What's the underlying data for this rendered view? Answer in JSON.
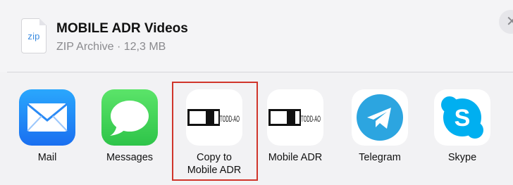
{
  "file": {
    "extension": "zip",
    "name": "MOBILE ADR Videos",
    "meta": "ZIP Archive · 12,3 MB"
  },
  "close": {
    "symbol": "✕"
  },
  "apps": [
    {
      "label": "Mail",
      "icon": "mail-icon"
    },
    {
      "label": "Messages",
      "icon": "messages-icon"
    },
    {
      "label": "Copy to\nMobile ADR",
      "line1": "Copy to",
      "line2": "Mobile ADR",
      "icon": "todd-ao-icon",
      "logo_text": "TODD-AO",
      "highlighted": true
    },
    {
      "label": "Mobile ADR",
      "icon": "todd-ao-icon",
      "logo_text": "TODD-AO"
    },
    {
      "label": "Telegram",
      "icon": "telegram-icon"
    },
    {
      "label": "Skype",
      "icon": "skype-icon",
      "logo_text": "S"
    }
  ],
  "colors": {
    "highlight": "#d0352b",
    "mail_blue": "#1a6ff0",
    "messages_green": "#2ec449",
    "telegram_blue": "#2ca5e0",
    "skype_blue": "#00aff0"
  }
}
